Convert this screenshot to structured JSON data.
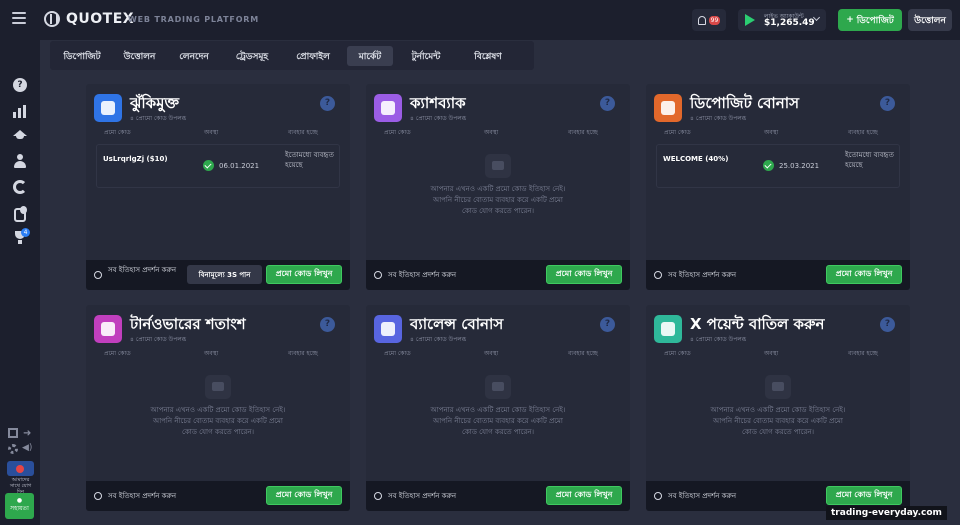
{
  "app": {
    "logo": "QUOTEX",
    "platform": "WEB TRADING PLATFORM"
  },
  "header": {
    "notif_badge": "99",
    "account_label": "লাইভ অ্যাকাউন্ট",
    "balance": "$1,265.49",
    "deposit_label": "ডিপোজিট",
    "deposit_plus": "+",
    "withdraw_label": "উত্তোলন"
  },
  "sidebar": {
    "trophy_badge": "4",
    "promo_text": "আমাদের সাথে যোগ দিন",
    "support": "সহায়তা"
  },
  "tabs": [
    "ডিপোজিট",
    "উত্তোলন",
    "লেনদেন",
    "ট্রেডসমূহ",
    "প্রোফাইল",
    "মার্কেট",
    "টুর্নামেন্ট",
    "বিশ্লেষণ"
  ],
  "active_tab": 5,
  "headers": {
    "code": "প্রমো কোড",
    "status": "অবস্থা",
    "usage": "ব্যবহার হচ্ছে"
  },
  "empty_text": "আপনার এখনও একটি প্রমো কোড ইতিহাস নেই। আপনি নীচের বোতাম ব্যবহার করে একটি প্রমো কোড যোগ করতে পারেন।",
  "history_label": "সব ইতিহাস প্রদর্শন করুন",
  "enter_label": "প্রমো কোড লিখুন",
  "free_label": "বিনামূল্যে 3S পান",
  "cards": [
    {
      "title": "ঝুঁকিমুক্ত",
      "subtitle": "৪ প্রোমো কোড উপলব্ধ",
      "icon": "shield-icon",
      "color": "#2f74e6",
      "row": {
        "code": "UsLrqrlgZj ($10)",
        "date": "06.01.2021",
        "status": "ইতোমধ্যে ব্যবহৃত হয়েছে"
      }
    },
    {
      "title": "ক্যাশব্যাক",
      "subtitle": "৪ প্রোমো কোড উপলব্ধ",
      "icon": "cashback-icon",
      "color": "#9b5de5"
    },
    {
      "title": "ডিপোজিট বোনাস",
      "subtitle": "৪ প্রোমো কোড উপলব্ধ",
      "icon": "money-bag-icon",
      "color": "#e2682b",
      "row": {
        "code": "WELCOME (40%)",
        "date": "25.03.2021",
        "status": "ইতোমধ্যে ব্যবহৃত হয়েছে"
      }
    },
    {
      "title": "টার্নওভারের শতাংশ",
      "subtitle": "৪ প্রোমো কোড উপলব্ধ",
      "icon": "percent-icon",
      "color": "#c13fbe"
    },
    {
      "title": "ব্যালেন্স বোনাস",
      "subtitle": "৪ প্রোমো কোড উপলব্ধ",
      "icon": "gift-icon",
      "color": "#5865e0"
    },
    {
      "title": "X পয়েন্ট বাতিল করুন",
      "subtitle": "৪ প্রোমো কোড উপলব্ধ",
      "icon": "cancel-gift-icon",
      "color": "#2fb89a"
    }
  ],
  "watermark": "trading-everyday.com"
}
